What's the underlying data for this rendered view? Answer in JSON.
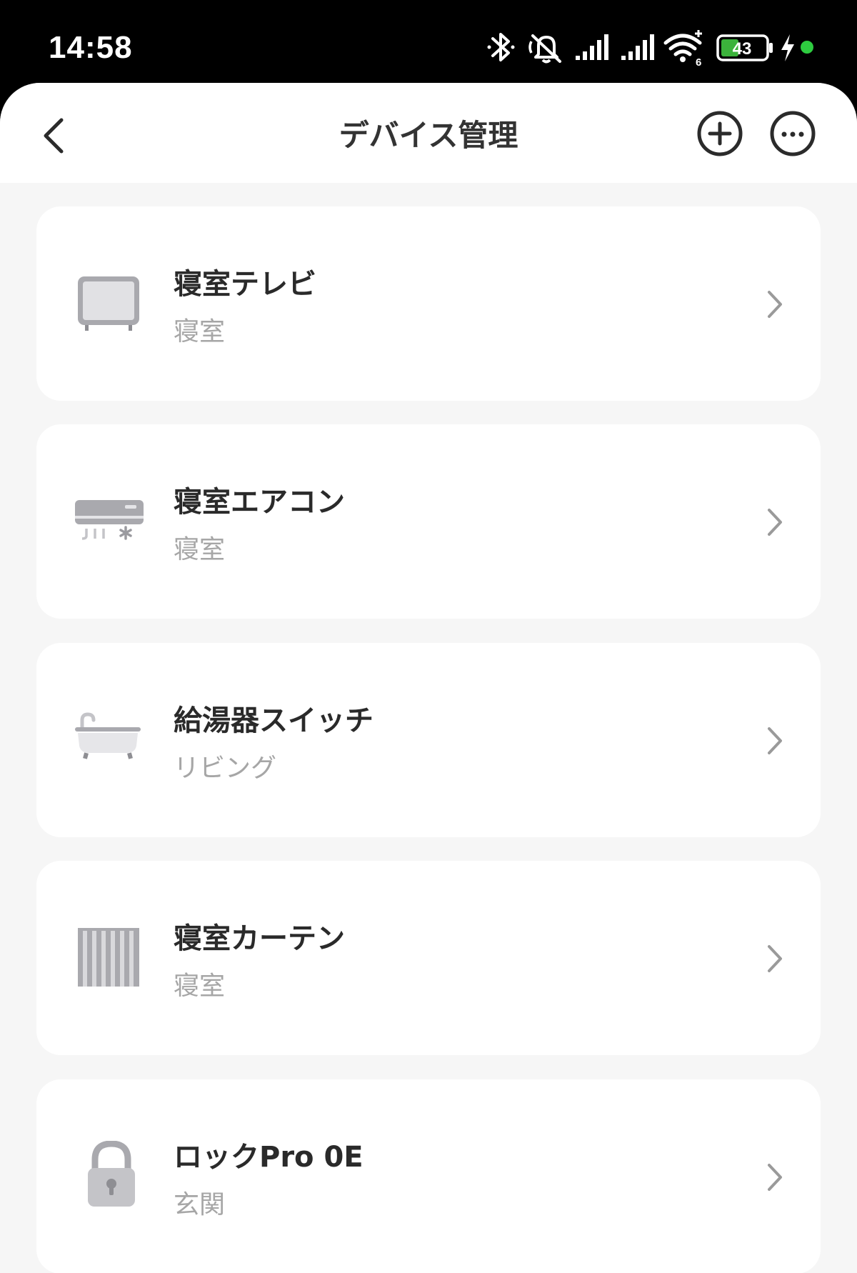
{
  "status_bar": {
    "time": "14:58",
    "battery_level": "43",
    "icons": [
      "bluetooth-icon",
      "muted-bell-icon",
      "signal-icon",
      "signal-icon",
      "wifi-icon",
      "battery-icon",
      "charging-icon",
      "dot-indicator"
    ],
    "wifi_badge": "6",
    "dot_color": "#2ecc40",
    "battery_fill_color": "#3bb33b"
  },
  "header": {
    "title": "デバイス管理",
    "back_icon": "chevron-left-icon",
    "add_icon": "plus-circle-icon",
    "more_icon": "more-horizontal-icon"
  },
  "devices": [
    {
      "name": "寝室テレビ",
      "room": "寝室",
      "icon": "tv-icon"
    },
    {
      "name": "寝室エアコン",
      "room": "寝室",
      "icon": "air-conditioner-icon"
    },
    {
      "name": "給湯器スイッチ",
      "room": "リビング",
      "icon": "bathtub-icon"
    },
    {
      "name": "寝室カーテン",
      "room": "寝室",
      "icon": "curtain-icon"
    },
    {
      "name": "ロックPro 0E",
      "room": "玄関",
      "icon": "lock-icon"
    }
  ],
  "colors": {
    "background": "#f6f6f6",
    "card": "#ffffff",
    "title_text": "#333333",
    "secondary_text": "#a6a6a6",
    "icon_gray": "#a9a9ae"
  }
}
